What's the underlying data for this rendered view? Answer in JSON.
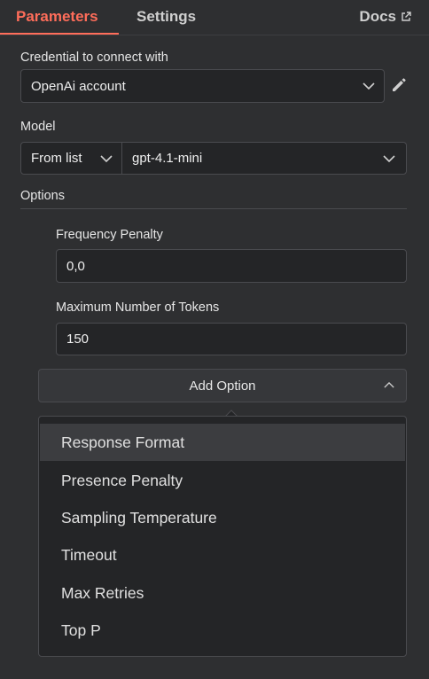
{
  "tabs": {
    "parameters": "Parameters",
    "settings": "Settings",
    "docs": "Docs"
  },
  "credential": {
    "label": "Credential to connect with",
    "value": "OpenAi account"
  },
  "model": {
    "label": "Model",
    "mode": "From list",
    "value": "gpt-4.1-mini"
  },
  "options": {
    "label": "Options",
    "frequency_penalty": {
      "label": "Frequency Penalty",
      "value": "0,0"
    },
    "max_tokens": {
      "label": "Maximum Number of Tokens",
      "value": "150"
    },
    "add_option_label": "Add Option",
    "menu": [
      "Response Format",
      "Presence Penalty",
      "Sampling Temperature",
      "Timeout",
      "Max Retries",
      "Top P"
    ]
  },
  "colors": {
    "accent": "#ff6d5a",
    "background": "#2e2f31",
    "field": "#242527"
  }
}
